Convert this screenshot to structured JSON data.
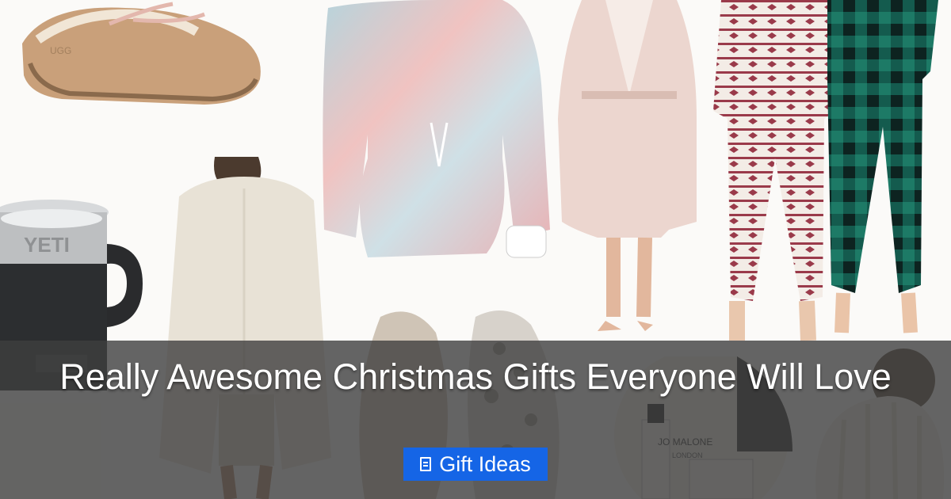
{
  "article": {
    "title": "Really Awesome Christmas Gifts Everyone Will Love",
    "category": {
      "icon": "folder-icon",
      "label": "Gift Ideas"
    }
  },
  "colors": {
    "overlay": "#3e3e3e",
    "category_button": "#1565e6",
    "title_text": "#ffffff"
  },
  "collage": {
    "products": [
      {
        "name": "sheepskin moccasin slipper",
        "brand_text": "UGG"
      },
      {
        "name": "insulated camp mug",
        "brand_text": "YETI"
      },
      {
        "name": "cream knit cardigan"
      },
      {
        "name": "tie-dye lounge set"
      },
      {
        "name": "plush blush robe"
      },
      {
        "name": "fair isle pajama set"
      },
      {
        "name": "green buffalo plaid pajama set"
      },
      {
        "name": "fuzzy leopard slippers"
      },
      {
        "name": "candle gift set",
        "brand_text": "JO MALONE LONDON"
      },
      {
        "name": "pom-pom knit beanie"
      }
    ]
  }
}
